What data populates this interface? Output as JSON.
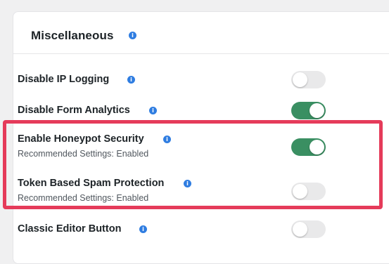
{
  "section": {
    "title": "Miscellaneous",
    "title_icon": "info-icon"
  },
  "settings": [
    {
      "label": "Disable IP Logging",
      "sub": "",
      "enabled": false
    },
    {
      "label": "Disable Form Analytics",
      "sub": "",
      "enabled": true
    },
    {
      "label": "Enable Honeypot Security",
      "sub": "Recommended Settings: Enabled",
      "enabled": true
    },
    {
      "label": "Token Based Spam Protection",
      "sub": "Recommended Settings: Enabled",
      "enabled": false
    },
    {
      "label": "Classic Editor Button",
      "sub": "",
      "enabled": false
    }
  ],
  "colors": {
    "toggle_on": "#3a8f62",
    "toggle_off": "#e9e9ea",
    "info_icon": "#2f7de1",
    "highlight_border": "#e53b5a"
  }
}
